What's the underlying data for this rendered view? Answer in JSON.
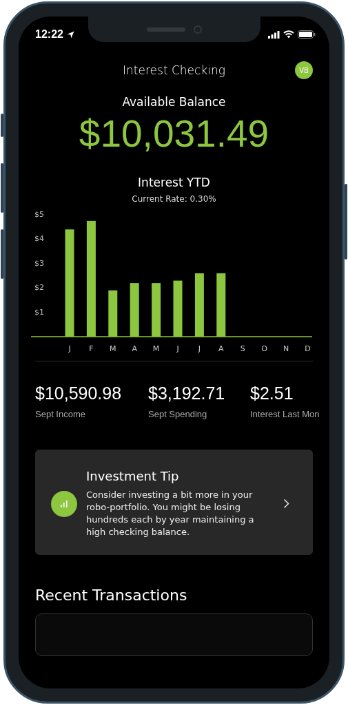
{
  "status_bar": {
    "time": "12:22"
  },
  "header": {
    "title": "Interest Checking",
    "avatar": "VB"
  },
  "balance": {
    "label": "Available Balance",
    "amount": "$10,031.49"
  },
  "interest": {
    "title": "Interest YTD",
    "subtitle": "Current Rate: 0.30%",
    "chart_data": {
      "type": "bar",
      "categories": [
        "J",
        "F",
        "M",
        "A",
        "M",
        "J",
        "J",
        "A",
        "S",
        "O",
        "N",
        "D"
      ],
      "series": [
        {
          "color": "#8dc63f",
          "values": [
            4.4,
            4.75,
            1.9,
            2.2,
            2.2,
            2.3,
            2.6,
            2.6,
            null,
            null,
            null,
            null
          ]
        }
      ],
      "ylim": [
        0,
        5
      ],
      "yticks": [
        {
          "value": 1,
          "label": "$1"
        },
        {
          "value": 2,
          "label": "$2"
        },
        {
          "value": 3,
          "label": "$3"
        },
        {
          "value": 4,
          "label": "$4"
        },
        {
          "value": 5,
          "label": "$5"
        }
      ]
    }
  },
  "stats": [
    {
      "value": "$10,590.98",
      "label": "Sept Income"
    },
    {
      "value": "$3,192.71",
      "label": "Sept Spending"
    },
    {
      "value": "$2.51",
      "label": "Interest Last Mon"
    }
  ],
  "tip": {
    "title": "Investment Tip",
    "text": "Consider investing a bit more in your robo-portfolio. You might be losing hundreds each by year maintaining a high checking balance."
  },
  "transactions": {
    "title": "Recent Transactions"
  }
}
